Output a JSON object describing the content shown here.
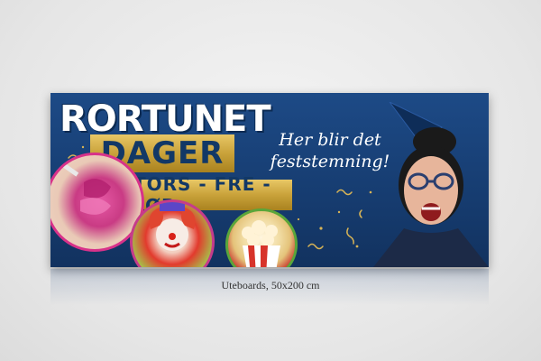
{
  "banner": {
    "brand": "RORTUNET",
    "title": "DAGER",
    "days": "TORS - FRE - LØR",
    "slogan_line1": "Her blir det",
    "slogan_line2": "feststemning!"
  },
  "caption": "Uteboards, 50x200 cm",
  "colors": {
    "banner_blue": "#1d4a86",
    "gold": "#c9a23a",
    "text_navy": "#123866",
    "accent_pink": "#d8328a"
  }
}
